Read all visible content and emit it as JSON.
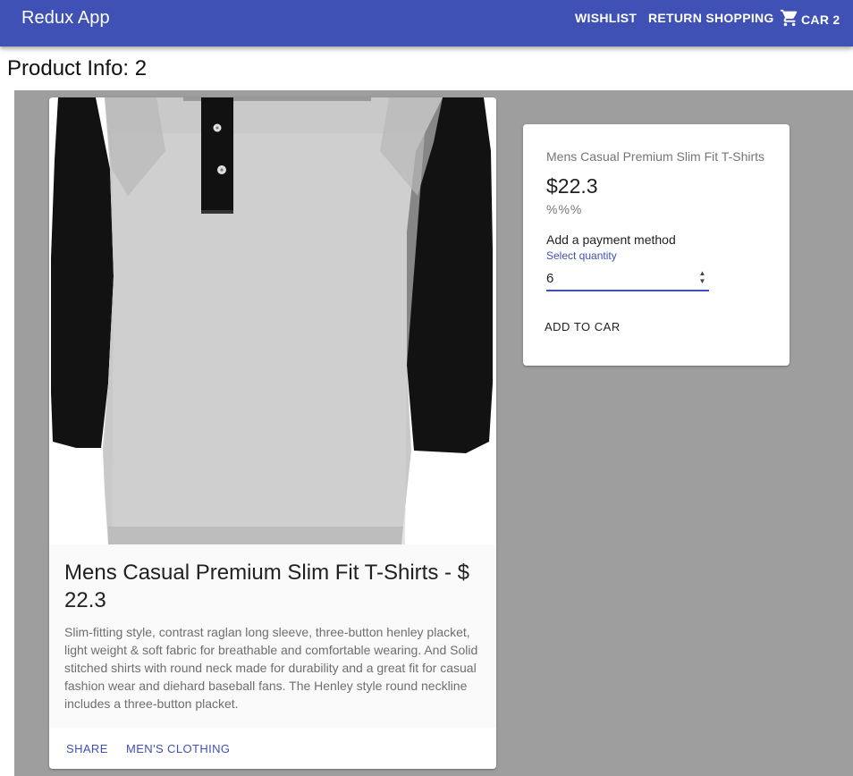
{
  "appbar": {
    "brand": "Redux App",
    "wishlist_label": "WISHLIST",
    "return_label": "RETURN SHOPPING",
    "cart_label": "CAR 2",
    "color": "#3f51b5"
  },
  "page": {
    "title": "Product Info: 2"
  },
  "product": {
    "name": "Mens Casual Premium Slim Fit T-Shirts - $ 22.3",
    "description": "Slim-fitting style, contrast raglan long sleeve, three-button henley placket, light weight & soft fabric for breathable and comfortable wearing. And Solid stitched shirts with round neck made for durability and a great fit for casual fashion wear and diehard baseball fans. The Henley style round neckline includes a three-button placket.",
    "share_label": "SHARE",
    "category_label": "MEN'S CLOTHING"
  },
  "purchase": {
    "title": "Mens Casual Premium Slim Fit T-Shirts",
    "price": "$22.3",
    "rating": "%%%",
    "payment_label": "Add a payment method",
    "quantity_label": "Select quantity",
    "quantity_value": "6",
    "add_button": "ADD TO CAR"
  }
}
